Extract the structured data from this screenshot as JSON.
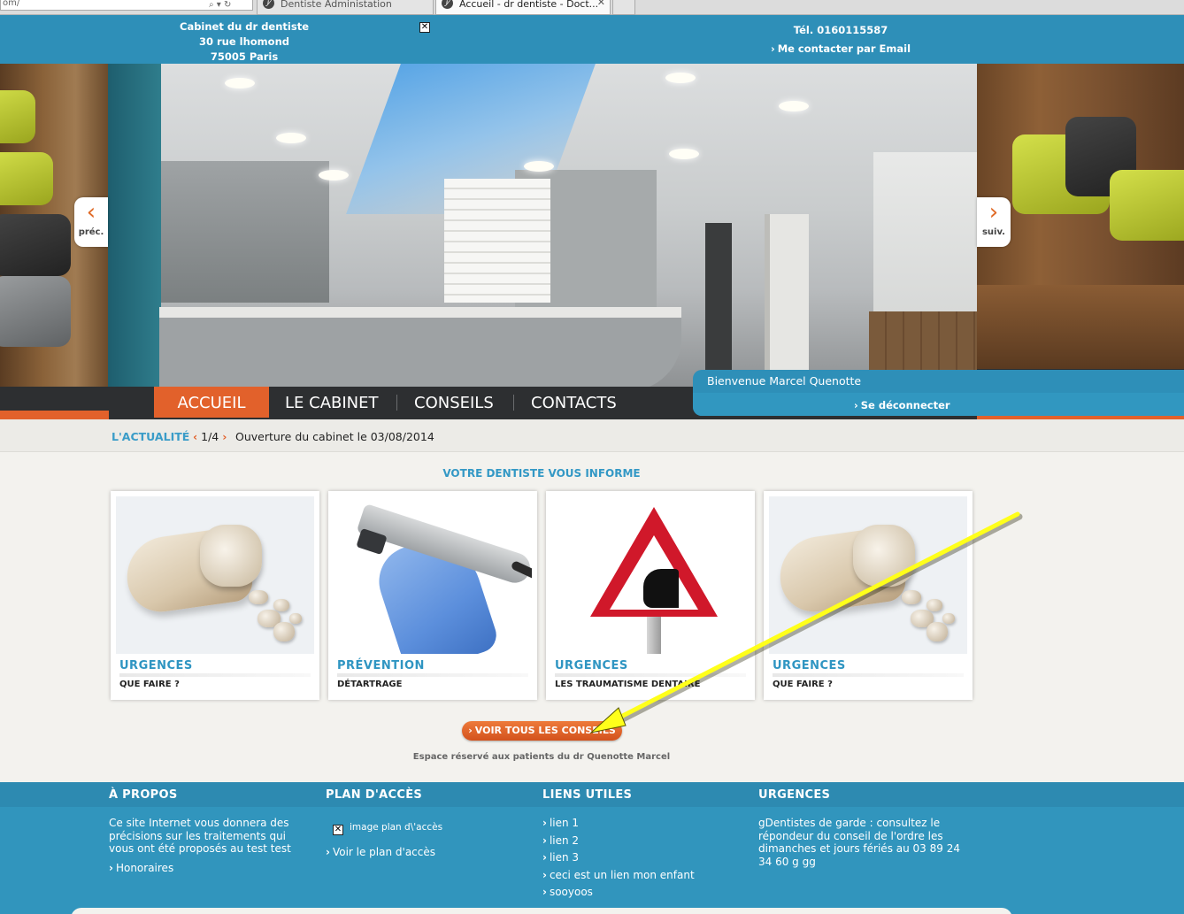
{
  "browser": {
    "address_partial": "om/",
    "tabs": [
      {
        "label": "Dentiste Administation",
        "active": false
      },
      {
        "label": "Accueil - dr dentiste - Doct...",
        "active": true
      }
    ]
  },
  "header": {
    "address_lines": [
      "Cabinet du dr dentiste",
      "30 rue lhomond",
      "75005 Paris"
    ],
    "phone": "Tél. 0160115587",
    "email_link": "Me contacter par Email"
  },
  "slider": {
    "prev_label": "préc.",
    "next_label": "suiv."
  },
  "nav": {
    "items": [
      "ACCUEIL",
      "LE CABINET",
      "CONSEILS",
      "CONTACTS"
    ],
    "active_index": 0
  },
  "user": {
    "welcome": "Bienvenue Marcel Quenotte",
    "logout": "Se déconnecter"
  },
  "news": {
    "label": "L'ACTUALITÉ",
    "position": "1/4",
    "message": "Ouverture du cabinet le 03/08/2014"
  },
  "advice": {
    "title": "VOTRE DENTISTE VOUS INFORME",
    "cards": [
      {
        "category": "URGENCES",
        "subtitle": "QUE FAIRE ?",
        "image": "tooth-illustration"
      },
      {
        "category": "PRÉVENTION",
        "subtitle": "DÉTARTRAGE",
        "image": "scanner-illustration"
      },
      {
        "category": "URGENCES",
        "subtitle": "LES TRAUMATISME DENTAIRE",
        "image": "warning-sign-illustration"
      },
      {
        "category": "URGENCES",
        "subtitle": "QUE FAIRE ?",
        "image": "tooth-illustration"
      }
    ],
    "all_button": "VOIR TOUS LES CONSEILS",
    "reserved_note": "Espace réservé aux patients du dr Quenotte Marcel"
  },
  "footer": {
    "about": {
      "title": "À PROPOS",
      "text": "Ce site Internet vous donnera des précisions sur les traitements qui vous ont été proposés au test test",
      "link": "Honoraires"
    },
    "access": {
      "title": "PLAN D'ACCÈS",
      "image_alt": "image plan d\\'accès",
      "link": "Voir le plan d'accès"
    },
    "links": {
      "title": "LIENS UTILES",
      "items": [
        "lien 1",
        "lien 2",
        "lien 3",
        "ceci est un lien mon enfant",
        "sooyoos"
      ]
    },
    "urgent": {
      "title": "URGENCES",
      "text": "gDentistes de garde : consultez le répondeur du conseil de l'ordre les dimanches et jours fériés au 03 89 24 34 60 g gg"
    }
  },
  "colors": {
    "primary_blue": "#2e8fb8",
    "accent_orange": "#e2612b",
    "nav_dark": "#2d2f31",
    "annotation_arrow": "#ffff00"
  }
}
